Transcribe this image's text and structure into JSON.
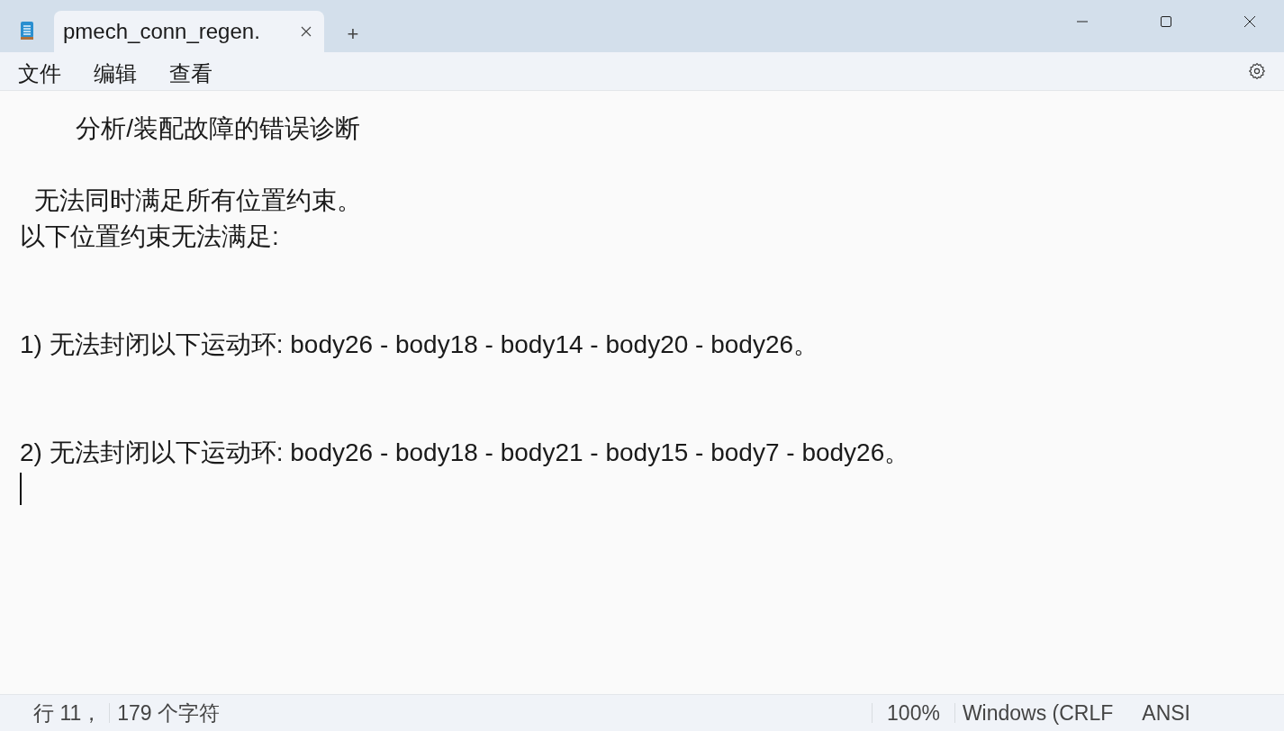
{
  "tabs": [
    {
      "label": "pmech_conn_regen.",
      "selected": true
    }
  ],
  "new_tab": "+",
  "menu": [
    "文件",
    "编辑",
    "查看"
  ],
  "editor": {
    "lines": [
      {
        "kind": "text",
        "text": "        分析/装配故障的错误诊断"
      },
      {
        "kind": "blank"
      },
      {
        "kind": "text",
        "text": "  无法同时满足所有位置约束。"
      },
      {
        "kind": "text",
        "text": "以下位置约束无法满足:"
      },
      {
        "kind": "blank"
      },
      {
        "kind": "blank"
      },
      {
        "kind": "text",
        "text": "1) 无法封闭以下运动环: body26 - body18 - body14 - body20 - body26。"
      },
      {
        "kind": "blank"
      },
      {
        "kind": "blank"
      },
      {
        "kind": "text",
        "text": "2) 无法封闭以下运动环: body26 - body18 - body21 - body15 - body7 - body26。"
      }
    ]
  },
  "status_bar": {
    "position": "行 11，",
    "count": "179 个字符",
    "zoom": "100%",
    "line_ending": "Windows (CRLF",
    "encoding": "ANSI"
  }
}
